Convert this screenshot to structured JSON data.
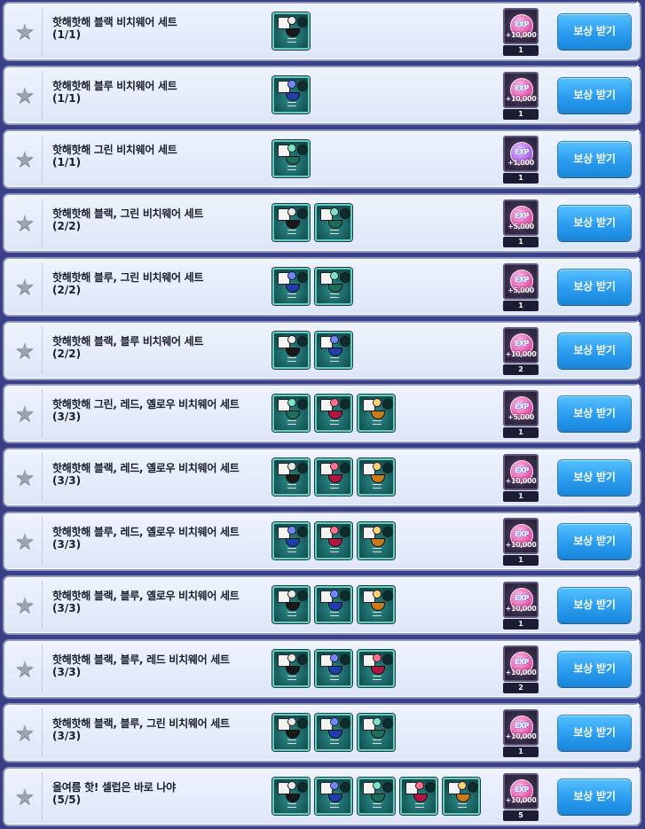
{
  "colors": {
    "background": "#3b3f86",
    "row_bg": "#e6edfb",
    "button": "#2b9cee",
    "item_teal": "#2f8f8c",
    "exp_orb_pink": "#ee5fae",
    "exp_orb_purple": "#b56bef"
  },
  "icons": {
    "star": "star-icon",
    "exp": "exp-orb-icon",
    "item": "bikini-item-icon"
  },
  "achievements": [
    {
      "title": "핫해핫해 블랙 비치웨어 세트",
      "progress": "(1/1)",
      "items": [
        "black"
      ],
      "reward": {
        "label": "EXP",
        "amount": "+10,000",
        "orb": "pink"
      },
      "quantity": "1",
      "button": "보상 받기"
    },
    {
      "title": "핫해핫해 블루 비치웨어 세트",
      "progress": "(1/1)",
      "items": [
        "blue"
      ],
      "reward": {
        "label": "EXP",
        "amount": "+10,000",
        "orb": "pink"
      },
      "quantity": "1",
      "button": "보상 받기"
    },
    {
      "title": "핫해핫해 그린 비치웨어 세트",
      "progress": "(1/1)",
      "items": [
        "green"
      ],
      "reward": {
        "label": "EXP",
        "amount": "+1,000",
        "orb": "purple"
      },
      "quantity": "1",
      "button": "보상 받기"
    },
    {
      "title": "핫해핫해 블랙, 그린 비치웨어 세트",
      "progress": "(2/2)",
      "items": [
        "black",
        "green"
      ],
      "reward": {
        "label": "EXP",
        "amount": "+5,000",
        "orb": "pink"
      },
      "quantity": "1",
      "button": "보상 받기"
    },
    {
      "title": "핫해핫해 블루, 그린 비치웨어 세트",
      "progress": "(2/2)",
      "items": [
        "blue",
        "green"
      ],
      "reward": {
        "label": "EXP",
        "amount": "+5,000",
        "orb": "pink"
      },
      "quantity": "1",
      "button": "보상 받기"
    },
    {
      "title": "핫해핫해 블랙, 블루 비치웨어 세트",
      "progress": "(2/2)",
      "items": [
        "black",
        "blue"
      ],
      "reward": {
        "label": "EXP",
        "amount": "+10,000",
        "orb": "pink"
      },
      "quantity": "2",
      "button": "보상 받기"
    },
    {
      "title": "핫해핫해 그린, 레드, 옐로우 비치웨어 세트",
      "progress": "(3/3)",
      "items": [
        "green",
        "red",
        "yellow"
      ],
      "reward": {
        "label": "EXP",
        "amount": "+5,000",
        "orb": "pink"
      },
      "quantity": "1",
      "button": "보상 받기"
    },
    {
      "title": "핫해핫해 블랙, 레드, 옐로우 비치웨어 세트",
      "progress": "(3/3)",
      "items": [
        "black",
        "red",
        "yellow"
      ],
      "reward": {
        "label": "EXP",
        "amount": "+10,000",
        "orb": "pink"
      },
      "quantity": "1",
      "button": "보상 받기"
    },
    {
      "title": "핫해핫해 블루, 레드, 옐로우 비치웨어 세트",
      "progress": "(3/3)",
      "items": [
        "blue",
        "red",
        "yellow"
      ],
      "reward": {
        "label": "EXP",
        "amount": "+10,000",
        "orb": "pink"
      },
      "quantity": "1",
      "button": "보상 받기"
    },
    {
      "title": "핫해핫해 블랙, 블루, 옐로우 비치웨어 세트",
      "progress": "(3/3)",
      "items": [
        "black",
        "blue",
        "yellow"
      ],
      "reward": {
        "label": "EXP",
        "amount": "+10,000",
        "orb": "pink"
      },
      "quantity": "1",
      "button": "보상 받기"
    },
    {
      "title": "핫해핫해 블랙, 블루, 레드 비치웨어 세트",
      "progress": "(3/3)",
      "items": [
        "black",
        "blue",
        "red"
      ],
      "reward": {
        "label": "EXP",
        "amount": "+10,000",
        "orb": "pink"
      },
      "quantity": "2",
      "button": "보상 받기"
    },
    {
      "title": "핫해핫해 블랙, 블루, 그린 비치웨어 세트",
      "progress": "(3/3)",
      "items": [
        "black",
        "blue",
        "green"
      ],
      "reward": {
        "label": "EXP",
        "amount": "+10,000",
        "orb": "pink"
      },
      "quantity": "1",
      "button": "보상 받기"
    },
    {
      "title": "올여름 핫! 셀럽은 바로 나야",
      "progress": "(5/5)",
      "items": [
        "black",
        "blue",
        "green",
        "red",
        "yellow"
      ],
      "reward": {
        "label": "EXP",
        "amount": "+10,000",
        "orb": "pink"
      },
      "quantity": "5",
      "button": "보상 받기"
    }
  ],
  "item_colors": {
    "black": "#1a1a1a",
    "blue": "#1f3fae",
    "green": "#1d6e5a",
    "red": "#b0173f",
    "yellow": "#c97a1a"
  },
  "item_accent": {
    "black": "#e9e9e9",
    "blue": "#6f86ff",
    "green": "#7ee3c4",
    "red": "#ff6f8f",
    "yellow": "#ffd07a"
  }
}
